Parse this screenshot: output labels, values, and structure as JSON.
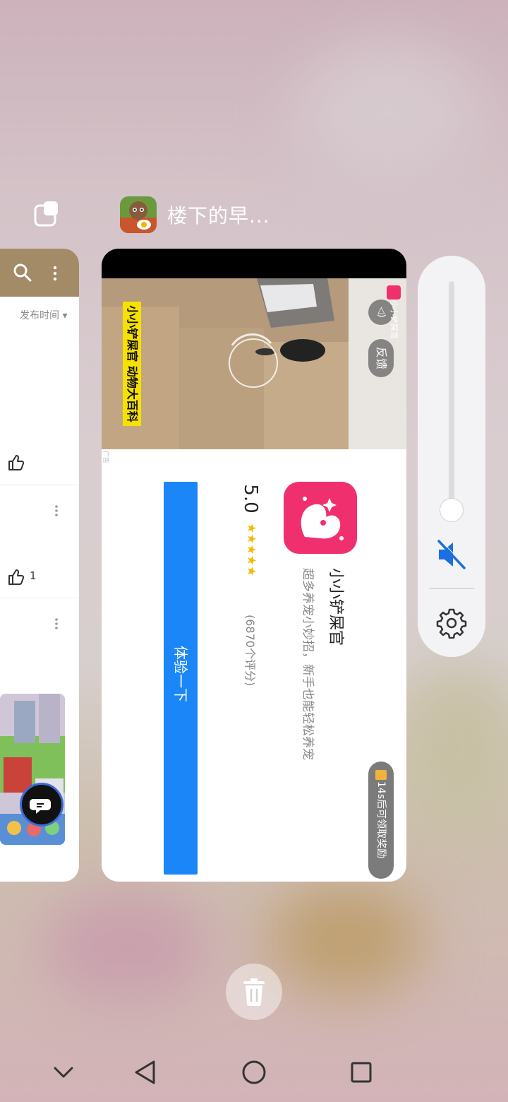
{
  "recent_app": {
    "title": "楼下的早...",
    "app_icon": "game-app-icon"
  },
  "left_card": {
    "sort_label": "发布时间 ▾",
    "like_count": "1"
  },
  "ad": {
    "video_caption": "小小铲屎官 动物大百科",
    "sound_label": "◁)",
    "feedback_label": "反馈",
    "corner_label": "小小铲屎官",
    "edge_label": "广告",
    "app_name": "小小铲屎官",
    "app_desc": "超多养宠小妙招，新手也能轻松养宠",
    "rating": "5.0",
    "stars": "★★★★★",
    "reviews": "(6870个评分)",
    "reward_label": "14s后可领取奖励",
    "cta_label": "体验一下"
  },
  "volume": {
    "level": 0,
    "muted": true
  },
  "colors": {
    "accent": "#1b86f7",
    "app_icon_bg": "#f0306e",
    "star": "#f5b800",
    "left_bar": "#a38b67"
  }
}
